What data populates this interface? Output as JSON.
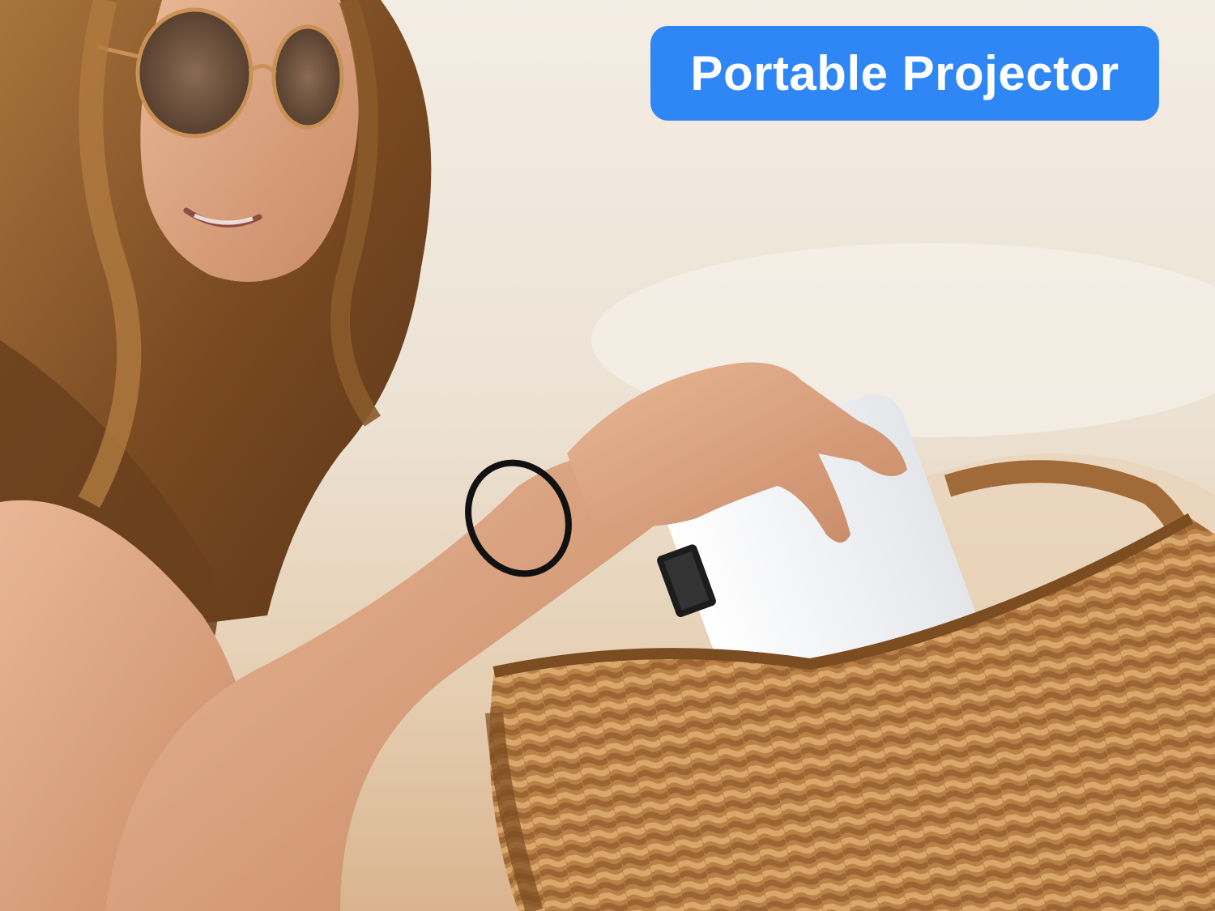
{
  "badge": {
    "label": "Portable Projector",
    "color": "#2f86f5",
    "text_color": "#ffffff"
  },
  "scene": {
    "subjects": [
      "woman-with-sunglasses",
      "white-projector",
      "woven-straw-bag"
    ]
  }
}
